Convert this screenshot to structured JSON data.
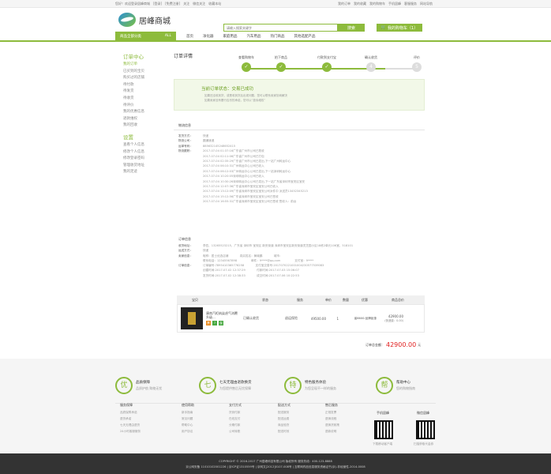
{
  "topbar": {
    "left": [
      "您好！欢迎登录居峰商城",
      "[登录]",
      "[免费注册]",
      "关注",
      "微信关注",
      "收藏本站"
    ],
    "right": [
      "我的订单",
      "我的收藏",
      "我的购物车",
      "手机居峰",
      "客服服务",
      "网站导航"
    ]
  },
  "logo": {
    "text": "居峰商城"
  },
  "search": {
    "placeholder": "请输入搜索关键字",
    "button": "搜索"
  },
  "cart": {
    "label": "我的购物车（1）"
  },
  "nav": {
    "category": "商品全部分类",
    "all": "ALL",
    "items": [
      "首页",
      "净化器",
      "家庭用品",
      "汽车用品",
      "热门商品",
      "其他选配产品"
    ]
  },
  "sidebar": {
    "title1": "订单中心",
    "links1": [
      "我的订单",
      "已买到的宝贝",
      "购买过的店铺",
      "待付款",
      "待发货",
      "待收货",
      "待评价",
      "我的优惠信息",
      "退款维权",
      "我的回收"
    ],
    "title2": "设置",
    "links2": [
      "查看个人信息",
      "修改个人信息",
      "修改登录密码",
      "管理收货地址",
      "我的足迹"
    ]
  },
  "order": {
    "title": "订单详情",
    "steps": [
      "查看购物车",
      "拍下商品",
      "付款到支付宝",
      "确认收货",
      "评价"
    ],
    "status": "当前订单状态：交易已成功",
    "tips": [
      "如果还没收到货，或是收到货后出现问题，您可以联系卖家协商解决",
      "如果卖家没有履行应尽的承诺，您可以“投诉维权”"
    ]
  },
  "logistics": {
    "title": "物流信息",
    "rows": [
      {
        "k": "发货方式：",
        "v": "快递"
      },
      {
        "k": "物流公司：",
        "v": "圆通速递"
      },
      {
        "k": "运单号码：",
        "v": "885632145248652415"
      },
      {
        "k": "物流跟踪：",
        "v": "2017-07-04 01:37:16广东省广州市公司已揽收"
      }
    ],
    "track": [
      "2017-07-04 02:11:06广东省广州市公司已打包",
      "2017-07-04 02:35:29广东省广州市公司已发出,下一站广州转运中心",
      "2017-07-04 06:10:31广州转运中心公司已收入",
      "2017-07-04 06:12:03广州转运中心公司已发出,下一站深圳转运中心",
      "2017-07-04 10:20:05深圳转运中心公司已收入",
      "2017-07-04 10:30:26深圳转运中心公司已发出,下一站广东省深圳市宝安区宝安",
      "2017-07-04 12:07:36广东省深圳市宝安区宝安公司已收入",
      "2017-07-04 13:12:09广东省深圳市宝安区宝安公司派件中 派送员13452345213",
      "2017-07-04 15:12:56广东省深圳市宝安区宝安公司已签收",
      "2017-07-04 16:55:31广东省深圳市宝安区宝安公司已签收 签收人：前台"
    ]
  },
  "orderinfo": {
    "title": "订单信息",
    "rows": [
      {
        "k": "收货地址：",
        "v": "李四，13265523215，广东省 深圳市 宝安区 新安街道 深圳市宝安区新安街道灵芝园小区18栋2单元106室，518101"
      },
      {
        "k": "运送方式：",
        "v": "快递"
      },
      {
        "k": "卖家信息：",
        "v": "昵称：居士优选店铺　　　　真实姓名：黄瑜鹏　　　　城市："
      },
      {
        "k": "",
        "v": "联系电话：12345567898　　　　　邮件：9****@qq.com　　　　　支付宝：9****"
      },
      {
        "k": "订单信息：",
        "v": "订单编号:7895410365776258　　　　支付宝交易号:2017070221001004230577539083"
      },
      {
        "k": "",
        "v": "创建时间:2017-07-02 12:37:29　　　　付款时间:2017-07-03 15:06:07"
      },
      {
        "k": "",
        "v": "发货时间:2017-07-02 12:38:33　　　　成交时间:2017-07-06 10:22:53"
      }
    ]
  },
  "goods": {
    "headers": [
      "宝贝",
      "状态",
      "服务",
      "单价",
      "数量",
      "优惠",
      "商品总价"
    ],
    "item": {
      "name": "康南汽柜纳染虑气浏覆升级...",
      "status": "已确认收货",
      "service": "退运保险",
      "price": "49500.00",
      "qty": "1",
      "discount": "省6600:品牌钜惠",
      "total": "42900.00",
      "shipping": "(快递费：0.00)"
    }
  },
  "total": {
    "label": "订单总金额：",
    "amount": "42900.00",
    "unit": "元"
  },
  "footer": {
    "services": [
      {
        "icon": "优",
        "t1": "品质保障",
        "t2": "品质护航 购物无忧"
      },
      {
        "icon": "七",
        "t1": "七天无理由退款换货",
        "t2": "为您提供售后无忧保障"
      },
      {
        "icon": "特",
        "t1": "特色服务体验",
        "t2": "为您呈现不一样的服务"
      },
      {
        "icon": "帮",
        "t1": "帮助中心",
        "t2": "您的购物指南"
      }
    ],
    "cols": [
      {
        "h": "服务保障",
        "l": [
          "品质保障承诺",
          "退货承诺",
          "七天无理由退货",
          "24小时客服服务"
        ]
      },
      {
        "h": "使用帮助",
        "l": [
          "新手指南",
          "常见问题",
          "帮助中心",
          "用户协议"
        ]
      },
      {
        "h": "支付方式",
        "l": [
          "货到付款",
          "在线支付",
          "分期付款",
          "公司转账"
        ]
      },
      {
        "h": "配送方式",
        "l": [
          "配送服务",
          "配送运费",
          "商品验货",
          "配送时效"
        ]
      },
      {
        "h": "售后服务",
        "l": [
          "正规发票",
          "退换流程",
          "退换货政策",
          "退款说明"
        ]
      }
    ],
    "qr1": {
      "title": "手机居峰",
      "label": "下载移动客户端"
    },
    "qr2": {
      "title": "微信居峰",
      "label": "扫描获取代金券"
    },
    "copyright": "COPYRIGHT © 2016-2017 广州居峰科技有限公司 版权所有 服务热线：400-123-8888",
    "icp": "京公网安备 11010102001226 | 京ICP证1310559号 | 京网文[2012]0107-008号 | 互联网药品信息服务资格证书(京)-非经营性-2014-0008"
  }
}
